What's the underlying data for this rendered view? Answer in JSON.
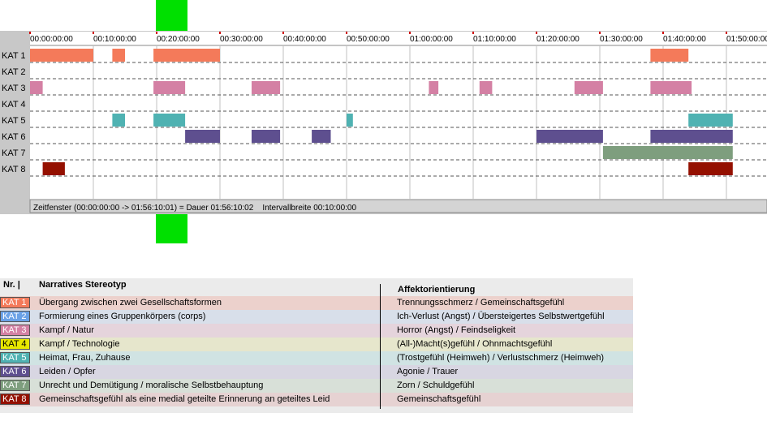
{
  "chart_data": {
    "type": "timeline",
    "x_ticks": [
      "00:00:00:00",
      "00:10:00:00",
      "00:20:00:00",
      "00:30:00:00",
      "00:40:00:00",
      "00:50:00:00",
      "01:00:00:00",
      "01:10:00:00",
      "01:20:00:00",
      "01:30:00:00",
      "01:40:00:00",
      "01:50:00:00"
    ],
    "x_range_minutes": [
      0,
      116.17
    ],
    "rows": [
      {
        "label": "KAT 1",
        "color": "#f47a5a",
        "segments": [
          [
            0,
            10
          ],
          [
            13,
            15
          ],
          [
            19.5,
            30
          ],
          [
            98,
            104
          ]
        ]
      },
      {
        "label": "KAT 2",
        "color": "#6aa1e6",
        "segments": []
      },
      {
        "label": "KAT 3",
        "color": "#d480a4",
        "segments": [
          [
            0,
            2
          ],
          [
            19.5,
            24.5
          ],
          [
            35,
            39.5
          ],
          [
            63,
            64.5
          ],
          [
            71,
            73
          ],
          [
            86,
            90.5
          ],
          [
            98,
            104.5
          ]
        ]
      },
      {
        "label": "KAT 4",
        "color": "#e8e800",
        "segments": []
      },
      {
        "label": "KAT 5",
        "color": "#4fb2b2",
        "segments": [
          [
            13,
            15
          ],
          [
            19.5,
            24.5
          ],
          [
            50,
            51
          ],
          [
            104,
            111
          ]
        ]
      },
      {
        "label": "KAT 6",
        "color": "#5e4f8f",
        "segments": [
          [
            24.5,
            30
          ],
          [
            35,
            39.5
          ],
          [
            44.5,
            47.5
          ],
          [
            80,
            90.5
          ],
          [
            98,
            111
          ]
        ]
      },
      {
        "label": "KAT 7",
        "color": "#7e9e7e",
        "segments": [
          [
            90.5,
            111
          ]
        ]
      },
      {
        "label": "KAT 8",
        "color": "#941000",
        "segments": [
          [
            2,
            5.5
          ],
          [
            104,
            111
          ]
        ]
      }
    ],
    "marker_minutes": 20,
    "grid": true
  },
  "status_bar": "Zeitfenster (00:00:00:00 -> 01:56:10:01) = Dauer 01:56:10:02    Intervallbreite 00:10:00:00",
  "legend": {
    "header": {
      "nr": "Nr. |",
      "stereotype": "Narratives Stereotyp",
      "affect": "Affektorientierung"
    },
    "rows": [
      {
        "kat": "KAT 1",
        "color": "#f47a5a",
        "bg": "#ecd1cc",
        "stereotype": "Übergang zwischen zwei Gesellschaftsformen",
        "affect": "Trennungsschmerz / Gemeinschaftsgefühl"
      },
      {
        "kat": "KAT 2",
        "color": "#6aa1e6",
        "bg": "#d8dfea",
        "stereotype": "Formierung eines Gruppenkörpers (corps)",
        "affect": "Ich-Verlust (Angst) / Übersteigertes Selbstwertgefühl"
      },
      {
        "kat": "KAT 3",
        "color": "#d480a4",
        "bg": "#e5d4dc",
        "stereotype": "Kampf / Natur",
        "affect": "Horror (Angst) / Feindseligkeit"
      },
      {
        "kat": "KAT 4",
        "color": "#e8e800",
        "bg": "#e6e6cc",
        "stereotype": "Kampf / Technologie",
        "affect": "(All-)Macht(s)gefühl / Ohnmachtsgefühl"
      },
      {
        "kat": "KAT 5",
        "color": "#4fb2b2",
        "bg": "#d0e3e3",
        "stereotype": "Heimat, Frau, Zuhause",
        "affect": "(Trostgefühl (Heimweh) / Verlustschmerz (Heimweh)"
      },
      {
        "kat": "KAT 6",
        "color": "#5e4f8f",
        "bg": "#d8d6e2",
        "stereotype": "Leiden / Opfer",
        "affect": "Agonie / Trauer"
      },
      {
        "kat": "KAT 7",
        "color": "#7e9e7e",
        "bg": "#d8e0d8",
        "stereotype": "Unrecht und Demütigung / moralische Selbstbehauptung",
        "affect": "Zorn / Schuldgefühl"
      },
      {
        "kat": "KAT 8",
        "color": "#941000",
        "bg": "#e6d2d2",
        "stereotype": "Gemeinschaftsgefühl als eine medial geteilte Erinnerung an geteiltes Leid",
        "affect": "Gemeinschaftsgefühl"
      }
    ]
  }
}
